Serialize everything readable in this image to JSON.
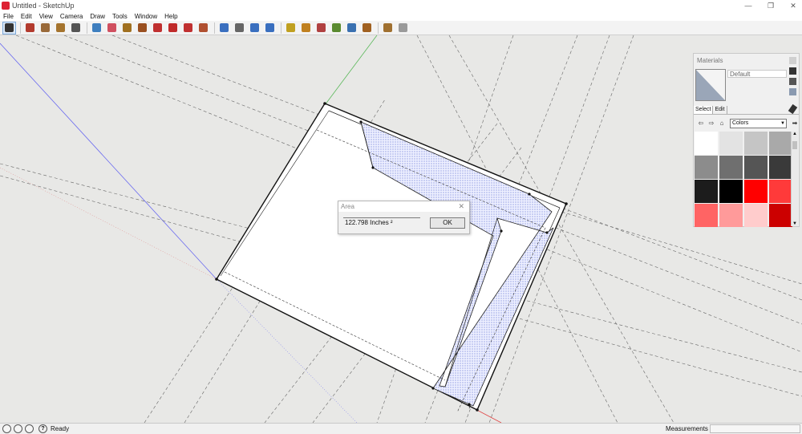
{
  "window": {
    "title": "Untitled - SketchUp",
    "controls": [
      "—",
      "❐",
      "✕"
    ]
  },
  "menu": [
    "File",
    "Edit",
    "View",
    "Camera",
    "Draw",
    "Tools",
    "Window",
    "Help"
  ],
  "toolbar": {
    "tools": [
      {
        "name": "select-tool-icon",
        "color": "#333333",
        "active": true
      },
      {
        "name": "pencil-tool-icon",
        "color": "#b33b2e"
      },
      {
        "name": "rectangle-tool-icon",
        "color": "#9a6a3a"
      },
      {
        "name": "circle-tool-icon",
        "color": "#a5742e"
      },
      {
        "name": "arc-tool-icon",
        "color": "#555555"
      },
      {
        "name": "eraser-tool-icon",
        "color": "#3f7fbf"
      },
      {
        "name": "paint-bucket-tool-icon",
        "color": "#d05060"
      },
      {
        "name": "tape-measure-tool-icon",
        "color": "#a07020"
      },
      {
        "name": "push-pull-tool-icon",
        "color": "#9a5020"
      },
      {
        "name": "move-tool-icon",
        "color": "#c03030"
      },
      {
        "name": "offset-tool-icon",
        "color": "#c02b2b"
      },
      {
        "name": "rotate-tool-icon",
        "color": "#c03030"
      },
      {
        "name": "follow-me-tool-icon",
        "color": "#b05030"
      },
      {
        "name": "orbit-tool-icon",
        "color": "#3a6fbf"
      },
      {
        "name": "pan-tool-icon",
        "color": "#666666"
      },
      {
        "name": "zoom-tool-icon",
        "color": "#3a6fbf"
      },
      {
        "name": "zoom-extents-tool-icon",
        "color": "#3a6fbf"
      },
      {
        "name": "3d-warehouse-icon",
        "color": "#c0a020"
      },
      {
        "name": "share-model-icon",
        "color": "#c08020"
      },
      {
        "name": "extension-warehouse-icon",
        "color": "#b04040"
      },
      {
        "name": "geo-location-icon",
        "color": "#5a8a30"
      },
      {
        "name": "add-location-icon",
        "color": "#3a70b0"
      },
      {
        "name": "layout-icon",
        "color": "#a06020"
      },
      {
        "name": "style-builder-icon",
        "color": "#a07030"
      },
      {
        "name": "components-icon",
        "color": "#9a9a9a"
      }
    ]
  },
  "dialog": {
    "title": "Area",
    "close": "✕",
    "value": "122.798 Inches ²",
    "ok_label": "OK"
  },
  "materials": {
    "title": "Materials",
    "material_name": "Default",
    "tabs": [
      "Select",
      "Edit"
    ],
    "library": "Colors",
    "nav": [
      "⇦",
      "⇨",
      "⌂"
    ],
    "swatches": [
      "#ffffff",
      "#e3e3e3",
      "#c5c5c5",
      "#a9a9a9",
      "#8c8c8c",
      "#6f6f6f",
      "#555555",
      "#3a3a3a",
      "#1c1c1c",
      "#000000",
      "#ff0000",
      "#ff3a3a",
      "#ff6464",
      "#ff9a9a",
      "#ffcccc",
      "#cc0000"
    ]
  },
  "status": {
    "ready": "Ready",
    "measurements_label": "Measurements",
    "help": "?"
  }
}
